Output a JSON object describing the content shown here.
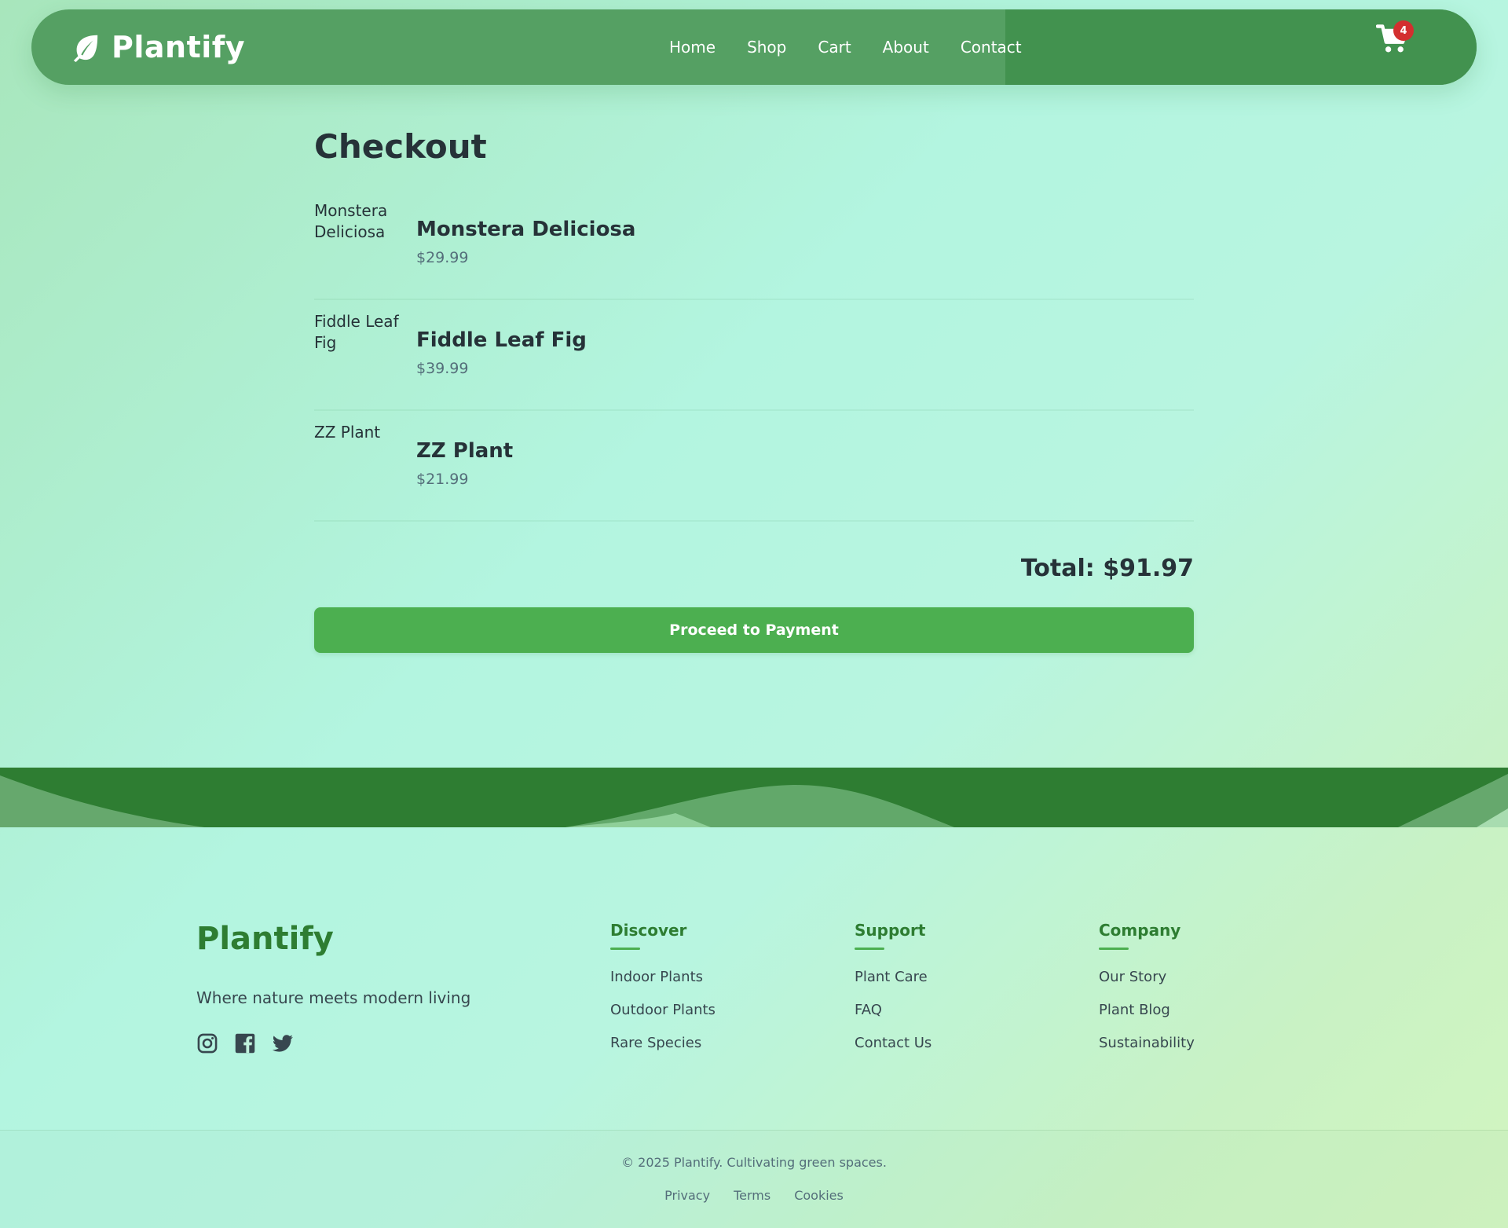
{
  "colors": {
    "nav_bg": "#55a063",
    "nav_right_bg": "#42924f",
    "accent": "#4caf50",
    "brand_green": "#2e7d32",
    "badge": "#d32f2f"
  },
  "nav": {
    "brand": "Plantify",
    "brand_icon": "leaf-icon",
    "links": [
      "Home",
      "Shop",
      "Cart",
      "About",
      "Contact"
    ],
    "cart_icon": "shopping-cart-icon",
    "cart_count": "4"
  },
  "checkout": {
    "title": "Checkout",
    "items": [
      {
        "image_alt": "Monstera Deliciosa",
        "name": "Monstera Deliciosa",
        "price": "$29.99"
      },
      {
        "image_alt": "Fiddle Leaf Fig",
        "name": "Fiddle Leaf Fig",
        "price": "$39.99"
      },
      {
        "image_alt": "ZZ Plant",
        "name": "ZZ Plant",
        "price": "$21.99"
      }
    ],
    "total": "Total: $91.97",
    "button": "Proceed to Payment"
  },
  "footer": {
    "logo": "Plantify",
    "tagline": "Where nature meets modern living",
    "socials": [
      "instagram-icon",
      "facebook-icon",
      "twitter-icon"
    ],
    "columns": [
      {
        "title": "Discover",
        "links": [
          "Indoor Plants",
          "Outdoor Plants",
          "Rare Species"
        ]
      },
      {
        "title": "Support",
        "links": [
          "Plant Care",
          "FAQ",
          "Contact Us"
        ]
      },
      {
        "title": "Company",
        "links": [
          "Our Story",
          "Plant Blog",
          "Sustainability"
        ]
      }
    ],
    "copyright": "© 2025 Plantify. Cultivating green spaces.",
    "legal": [
      "Privacy",
      "Terms",
      "Cookies"
    ]
  }
}
